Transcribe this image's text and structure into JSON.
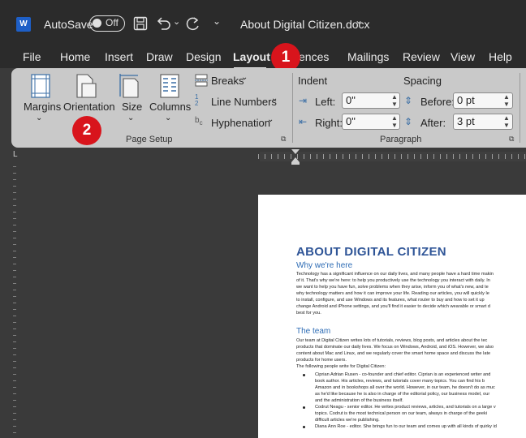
{
  "titlebar": {
    "app_icon_letter": "W",
    "autosave_label": "AutoSave",
    "autosave_toggle": "Off",
    "document_title": "About Digital Citizen.docx",
    "icons": [
      "save-icon",
      "undo-icon",
      "redo-icon",
      "customize-toolbar-icon"
    ]
  },
  "tabs": [
    {
      "label": "File"
    },
    {
      "label": "Home"
    },
    {
      "label": "Insert"
    },
    {
      "label": "Draw"
    },
    {
      "label": "Design"
    },
    {
      "label": "Layout",
      "selected": true
    },
    {
      "label": "ences"
    },
    {
      "label": "Mailings"
    },
    {
      "label": "Review"
    },
    {
      "label": "View"
    },
    {
      "label": "Help"
    }
  ],
  "callouts": {
    "one": "1",
    "two": "2"
  },
  "page_setup": {
    "margins": "Margins",
    "orientation": "Orientation",
    "size": "Size",
    "columns": "Columns",
    "breaks": "Breaks",
    "line_numbers": "Line Numbers",
    "hyphenation": "Hyphenation",
    "group_label": "Page Setup"
  },
  "paragraph": {
    "indent_title": "Indent",
    "spacing_title": "Spacing",
    "left_label": "Left:",
    "left_value": "0\"",
    "right_label": "Right:",
    "right_value": "0\"",
    "before_label": "Before:",
    "before_value": "0 pt",
    "after_label": "After:",
    "after_value": "3 pt",
    "group_label": "Paragraph"
  },
  "document": {
    "heading": "About Digital Citizen",
    "why_title": "Why we're here",
    "why_lines": [
      "Technology has a significant influence on our daily lives, and many people have a hard time makin",
      "of it. That's why we're here: to help you productively use the technology you interact with daily. In",
      "we want to help you have fun, solve problems when they arise, inform you of what's new, and te",
      "why technology matters and how it can improve your life. Reading our articles, you will quickly le",
      "to install, configure, and use Windows and its features, what router to buy and how to set it up",
      "change Android and iPhone settings, and you'll find it easier to decide which wearable or smart d",
      "best for you."
    ],
    "team_title": "The team",
    "team_lines": [
      "Our team at Digital Citizen writes lots of tutorials, reviews, blog posts, and articles about the tec",
      "products that dominate our daily lives. We focus on Windows, Android, and iOS. However, we also",
      "content about Mac and Linux, and we regularly cover the smart home space and discuss the late",
      "products for home users.",
      "The following people write for Digital Citizen:"
    ],
    "bullets": [
      {
        "lines": [
          "Ciprian Adrian Rusen - co-founder and chief editor. Ciprian is an experienced writer and",
          "book author. His articles, reviews, and tutorials cover many topics. You can find his b",
          "Amazon and in bookshops all over the world. However, in our team, he doesn't do as muc",
          "as he'd like because he is also in charge of the editorial policy, our business model, our",
          "and the administration of the business itself."
        ]
      },
      {
        "lines": [
          "Codrut Neagu - senior editor. He writes product reviews, articles, and tutorials on a large v",
          "topics. Codrut is the most technical person on our team, always in charge of the geeki",
          "difficult articles we're publishing."
        ]
      },
      {
        "lines": [
          "Diana Ann Roe - editor. She brings fun to our team and comes up with all kinds of quirky id"
        ]
      }
    ]
  }
}
